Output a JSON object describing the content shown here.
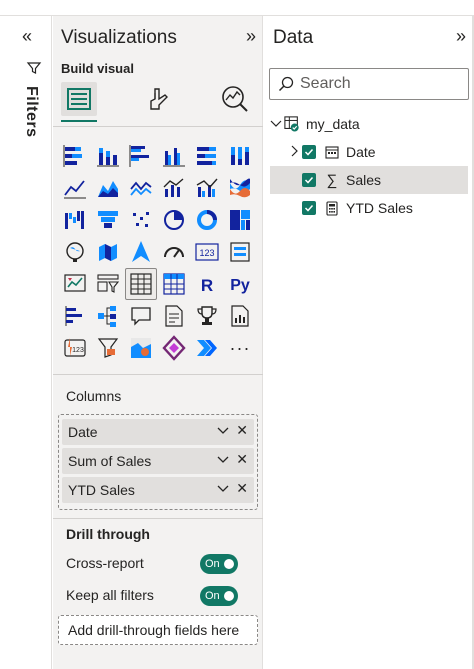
{
  "filters": {
    "label": "Filters",
    "collapse_glyph": "«",
    "icon": "filter-icon"
  },
  "visualizations": {
    "title": "Visualizations",
    "expand_glyph": "»",
    "build_visual_label": "Build visual",
    "build_icons": [
      "visual-grid-icon",
      "format-brush-icon",
      "analytics-icon"
    ],
    "visual_types": [
      "stacked-bar-icon",
      "stacked-column-icon",
      "clustered-bar-icon",
      "clustered-column-icon",
      "100-bar-icon",
      "100-column-icon",
      "line-chart-icon",
      "area-chart-icon",
      "stacked-area-icon",
      "line-column-icon",
      "line-clustered-icon",
      "ribbon-chart-icon",
      "waterfall-icon",
      "funnel-icon",
      "scatter-icon",
      "pie-icon",
      "donut-icon",
      "treemap-icon",
      "map-icon",
      "filled-map-icon",
      "azure-map-icon",
      "gauge-icon",
      "card-icon",
      "multirow-card-icon",
      "kpi-icon",
      "slicer-icon",
      "table-icon",
      "matrix-icon",
      "r-visual-icon",
      "python-visual-icon",
      "key-influencers-icon",
      "decomposition-tree-icon",
      "qa-icon",
      "narrative-icon",
      "goals-icon",
      "paginated-report-icon",
      "power-apps-icon",
      "power-automate-icon",
      "arcgis-icon",
      "powerapps-diamond-icon",
      "power-automate-chevron-icon",
      "more-visuals-icon"
    ],
    "selected_visual_index": 26,
    "r_label": "R",
    "py_label": "Py",
    "card_label": "123",
    "more_label": "···",
    "columns_label": "Columns",
    "wells": [
      "Date",
      "Sum of Sales",
      "YTD Sales"
    ],
    "drill_through_title": "Drill through",
    "cross_report_label": "Cross-report",
    "keep_filters_label": "Keep all filters",
    "toggle_on_label": "On",
    "drill_field_placeholder": "Add drill-through fields here"
  },
  "data_pane": {
    "title": "Data",
    "expand_glyph": "»",
    "search_placeholder": "Search",
    "table_name": "my_data",
    "fields": [
      {
        "label": "Date",
        "icon": "calendar-icon",
        "expandable": true
      },
      {
        "label": "Sales",
        "icon": "sigma-icon",
        "expandable": false
      },
      {
        "label": "YTD Sales",
        "icon": "calculator-icon",
        "expandable": false
      }
    ],
    "sigma_glyph": "∑"
  },
  "colors": {
    "accent_green": "#117865",
    "pane_bg": "#f3f2f1",
    "chart_blue": "#118dff",
    "chart_navy": "#12239e",
    "chart_orange": "#e66c37"
  }
}
